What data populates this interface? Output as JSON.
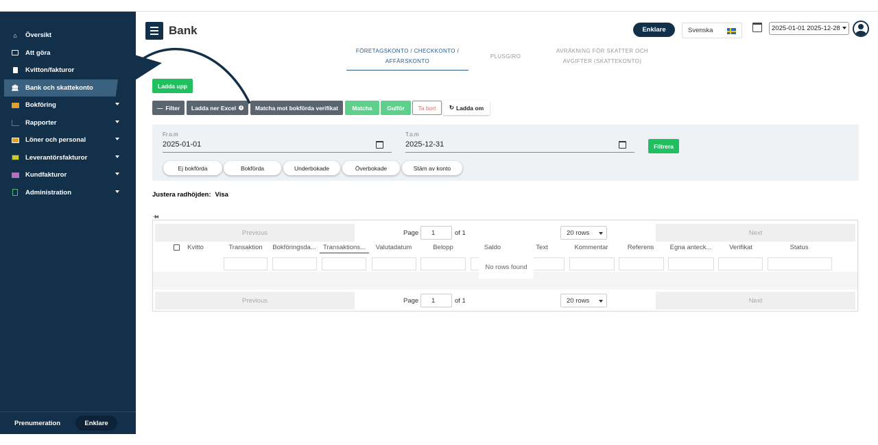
{
  "sidebar": {
    "items": [
      {
        "label": "Översikt",
        "icon": "home-icon",
        "caret": false
      },
      {
        "label": "Att göra",
        "icon": "list-icon",
        "caret": false
      },
      {
        "label": "Kvitton/fakturor",
        "icon": "document-icon",
        "caret": false
      },
      {
        "label": "Bank och skattekonto",
        "icon": "bank-icon",
        "caret": false,
        "active": true
      },
      {
        "label": "Bokföring",
        "icon": "book-icon",
        "caret": true
      },
      {
        "label": "Rapporter",
        "icon": "chart-icon",
        "caret": true
      },
      {
        "label": "Löner och personal",
        "icon": "card-icon",
        "caret": true
      },
      {
        "label": "Leverantörsfakturor",
        "icon": "supplier-icon",
        "caret": true
      },
      {
        "label": "Kundfakturor",
        "icon": "customer-icon",
        "caret": true
      },
      {
        "label": "Administration",
        "icon": "admin-icon",
        "caret": true
      }
    ],
    "subscription_label": "Prenumeration",
    "subscription_plan": "Enklare"
  },
  "header": {
    "title": "Bank",
    "plan_badge": "Enklare",
    "language": "Svenska",
    "date_range": "2025-01-01 2025-12-28"
  },
  "tabs": [
    {
      "label": "FÖRETAGSKONTO / CHECKKONTO / AFFÄRSKONTO",
      "active": true
    },
    {
      "label": "PLUSGIRO",
      "active": false
    },
    {
      "label": "AVRÄKNING FÖR SKATTER OCH AVGIFTER (SKATTEKONTO)",
      "active": false
    }
  ],
  "toolbar": {
    "upload": "Ladda upp",
    "filter": "Filter",
    "excel": "Ladda ner Excel",
    "match_verified": "Matcha mot bokförda verifikat",
    "match": "Matcha",
    "gulfor": "Gulför",
    "delete": "Ta bort",
    "reload": "Ladda om"
  },
  "filter_panel": {
    "from_label": "Fr.o.m",
    "from_value": "2025-01-01",
    "to_label": "T.o.m",
    "to_value": "2025-12-31",
    "apply": "Filtrera",
    "pills": [
      "Ej bokförda",
      "Bokförda",
      "Underbokade",
      "Överbokade",
      "Stäm av konto"
    ]
  },
  "row_height": {
    "label": "Justera radhöjden:",
    "value": "Visa"
  },
  "table": {
    "pagination": {
      "previous": "Previous",
      "next": "Next",
      "page_label": "Page",
      "page_value": "1",
      "of_label": "of 1",
      "rows": "20 rows"
    },
    "columns": [
      "Kvitto",
      "Transaktion",
      "Bokföringsda...",
      "Transaktions...",
      "Valutadatum",
      "Belopp",
      "Saldo",
      "Text",
      "Kommentar",
      "Referens",
      "Egna anteck...",
      "Verifikat",
      "Status"
    ],
    "empty": "No rows found"
  }
}
